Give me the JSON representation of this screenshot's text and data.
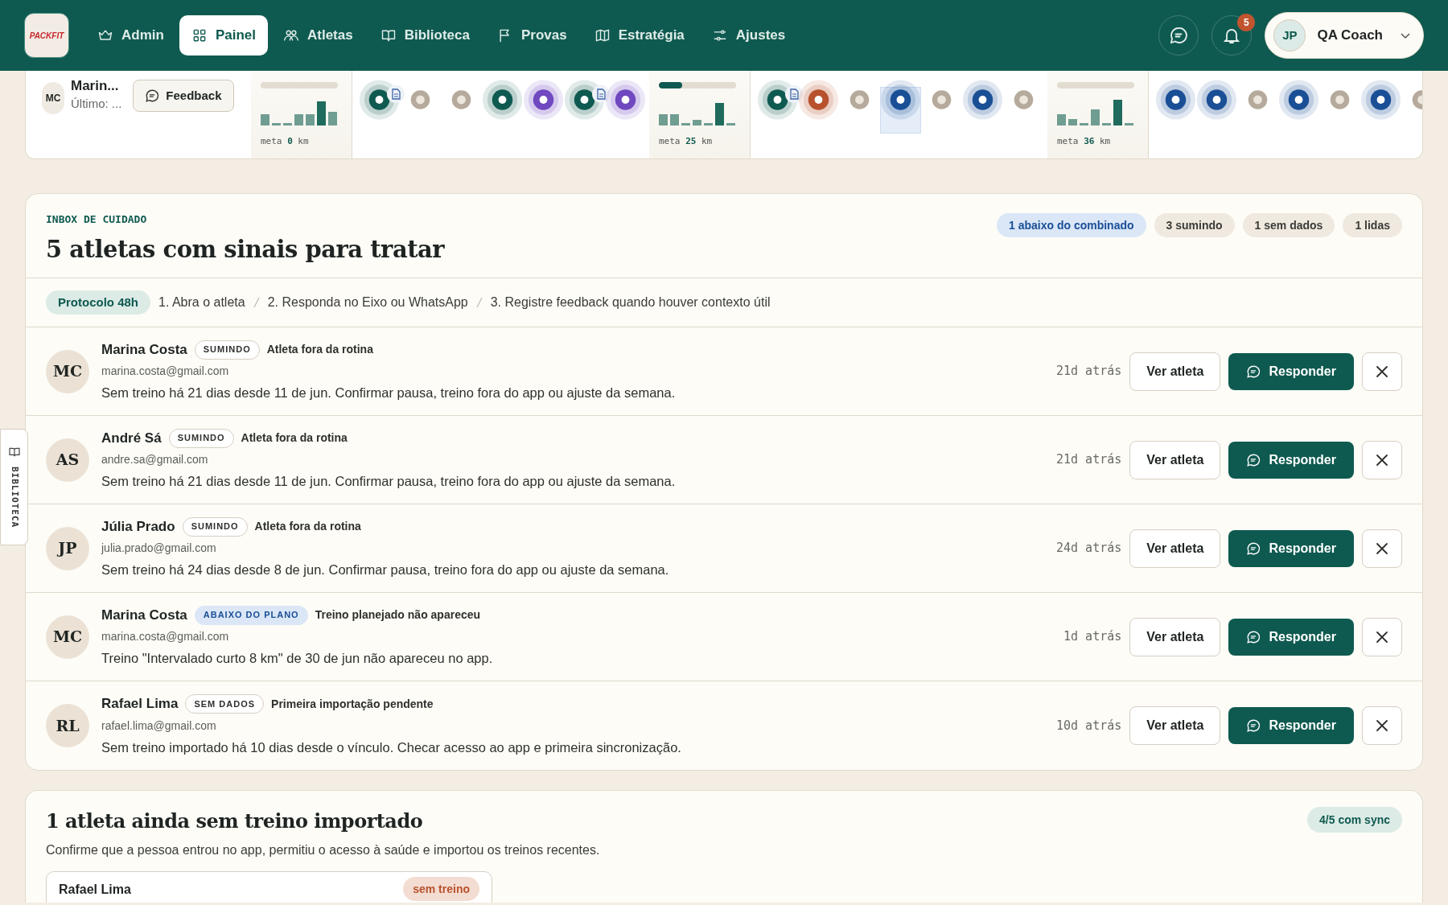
{
  "nav": {
    "logo": "PACKFIT",
    "items": [
      {
        "label": "Admin",
        "selected": false
      },
      {
        "label": "Painel",
        "selected": true
      },
      {
        "label": "Atletas",
        "selected": false
      },
      {
        "label": "Biblioteca",
        "selected": false
      },
      {
        "label": "Provas",
        "selected": false
      },
      {
        "label": "Estratégia",
        "selected": false
      },
      {
        "label": "Ajustes",
        "selected": false
      }
    ],
    "notifications": "5",
    "user": {
      "initials": "JP",
      "name": "QA Coach"
    }
  },
  "strip": {
    "athlete": {
      "initials": "MC",
      "name": "Marin...",
      "last": "Último: ..."
    },
    "feedback_button": "Feedback",
    "weeks": [
      {
        "goal": {
          "text": "meta **0** km"
        }
      },
      {
        "days": [
          {
            "color": "#0f5a50",
            "halo": true,
            "note": true,
            "selected": false
          },
          {
            "color": "#b5aa9b",
            "halo": false,
            "note": false,
            "selected": false
          },
          {
            "color": "#b5aa9b",
            "halo": false,
            "note": false,
            "selected": false
          },
          {
            "color": "#0f5a50",
            "halo": true,
            "note": false,
            "selected": false
          },
          {
            "color": "#7048c0",
            "halo": true,
            "note": false,
            "selected": false
          },
          {
            "color": "#0f5a50",
            "halo": true,
            "note": true,
            "selected": false
          },
          {
            "color": "#7048c0",
            "halo": true,
            "note": false,
            "selected": false
          }
        ],
        "goal": {
          "level": 0.3,
          "text": "meta **25** km"
        }
      },
      {
        "days": [
          {
            "color": "#0f5a50",
            "halo": true,
            "note": true,
            "selected": false
          },
          {
            "color": "#b8522e",
            "halo": true,
            "note": false,
            "selected": false
          },
          {
            "color": "#b5aa9b",
            "halo": false,
            "note": false,
            "selected": false
          },
          {
            "color": "#1a4f96",
            "halo": true,
            "note": false,
            "selected": true
          },
          {
            "color": "#b5aa9b",
            "halo": false,
            "note": false,
            "selected": false
          },
          {
            "color": "#1a4f96",
            "halo": true,
            "note": false,
            "selected": false
          },
          {
            "color": "#b5aa9b",
            "halo": false,
            "note": false,
            "selected": false
          }
        ],
        "goal": {
          "text": "meta **36** km"
        }
      },
      {
        "days": [
          {
            "color": "#1a4f96",
            "halo": true,
            "note": false,
            "selected": false
          },
          {
            "color": "#1a4f96",
            "halo": true,
            "note": false,
            "selected": false
          },
          {
            "color": "#b5aa9b",
            "halo": false,
            "note": false,
            "selected": false
          },
          {
            "color": "#1a4f96",
            "halo": true,
            "note": false,
            "selected": false
          },
          {
            "color": "#b5aa9b",
            "halo": false,
            "note": false,
            "selected": false
          },
          {
            "color": "#1a4f96",
            "halo": true,
            "note": false,
            "selected": false
          },
          {
            "color": "#b5aa9b",
            "halo": false,
            "note": false,
            "selected": false
          }
        ]
      }
    ]
  },
  "side_tab": "BIBLIOTECA",
  "inbox": {
    "eyebrow": "INBOX DE CUIDADO",
    "title": "5 atletas com sinais para tratar",
    "chips": [
      {
        "label": "1 abaixo do combinado",
        "highlighted": true
      },
      {
        "label": "3 sumindo",
        "highlighted": false
      },
      {
        "label": "1 sem dados",
        "highlighted": false
      },
      {
        "label": "1 lidas",
        "highlighted": false
      }
    ],
    "protocol": {
      "badge": "Protocolo 48h",
      "steps": [
        "1. Abra o atleta",
        "2. Responda no Eixo ou WhatsApp",
        "3. Registre feedback quando houver contexto útil"
      ]
    },
    "rows": [
      {
        "initials": "MC",
        "name": "Marina Costa",
        "tag": {
          "label": "SUMINDO",
          "highlighted": false
        },
        "reason": "Atleta fora da rotina",
        "email": "marina.costa@gmail.com",
        "message": "Sem treino há 21 dias desde 11 de jun. Confirmar pausa, treino fora do app ou ajuste da semana.",
        "time": "21d atrás",
        "view": "Ver atleta",
        "reply": "Responder"
      },
      {
        "initials": "AS",
        "name": "André Sá",
        "tag": {
          "label": "SUMINDO",
          "highlighted": false
        },
        "reason": "Atleta fora da rotina",
        "email": "andre.sa@gmail.com",
        "message": "Sem treino há 21 dias desde 11 de jun. Confirmar pausa, treino fora do app ou ajuste da semana.",
        "time": "21d atrás",
        "view": "Ver atleta",
        "reply": "Responder"
      },
      {
        "initials": "JP",
        "name": "Júlia Prado",
        "tag": {
          "label": "SUMINDO",
          "highlighted": false
        },
        "reason": "Atleta fora da rotina",
        "email": "julia.prado@gmail.com",
        "message": "Sem treino há 24 dias desde 8 de jun. Confirmar pausa, treino fora do app ou ajuste da semana.",
        "time": "24d atrás",
        "view": "Ver atleta",
        "reply": "Responder"
      },
      {
        "initials": "MC",
        "name": "Marina Costa",
        "tag": {
          "label": "ABAIXO DO PLANO",
          "highlighted": true
        },
        "reason": "Treino planejado não apareceu",
        "email": "marina.costa@gmail.com",
        "message": "Treino \"Intervalado curto 8 km\" de 30 de jun não apareceu no app.",
        "time": "1d atrás",
        "view": "Ver atleta",
        "reply": "Responder"
      },
      {
        "initials": "RL",
        "name": "Rafael Lima",
        "tag": {
          "label": "SEM DADOS",
          "highlighted": false
        },
        "reason": "Primeira importação pendente",
        "email": "rafael.lima@gmail.com",
        "message": "Sem treino importado há 10 dias desde o vínculo. Checar acesso ao app e primeira sincronização.",
        "time": "10d atrás",
        "view": "Ver atleta",
        "reply": "Responder"
      }
    ]
  },
  "sync": {
    "title": "1 atleta ainda sem treino importado",
    "subtitle": "Confirme que a pessoa entrou no app, permitiu o acesso à saúde e importou os treinos recentes.",
    "chip": "4/5 com sync",
    "card": {
      "name": "Rafael Lima",
      "badge": "sem treino"
    }
  }
}
